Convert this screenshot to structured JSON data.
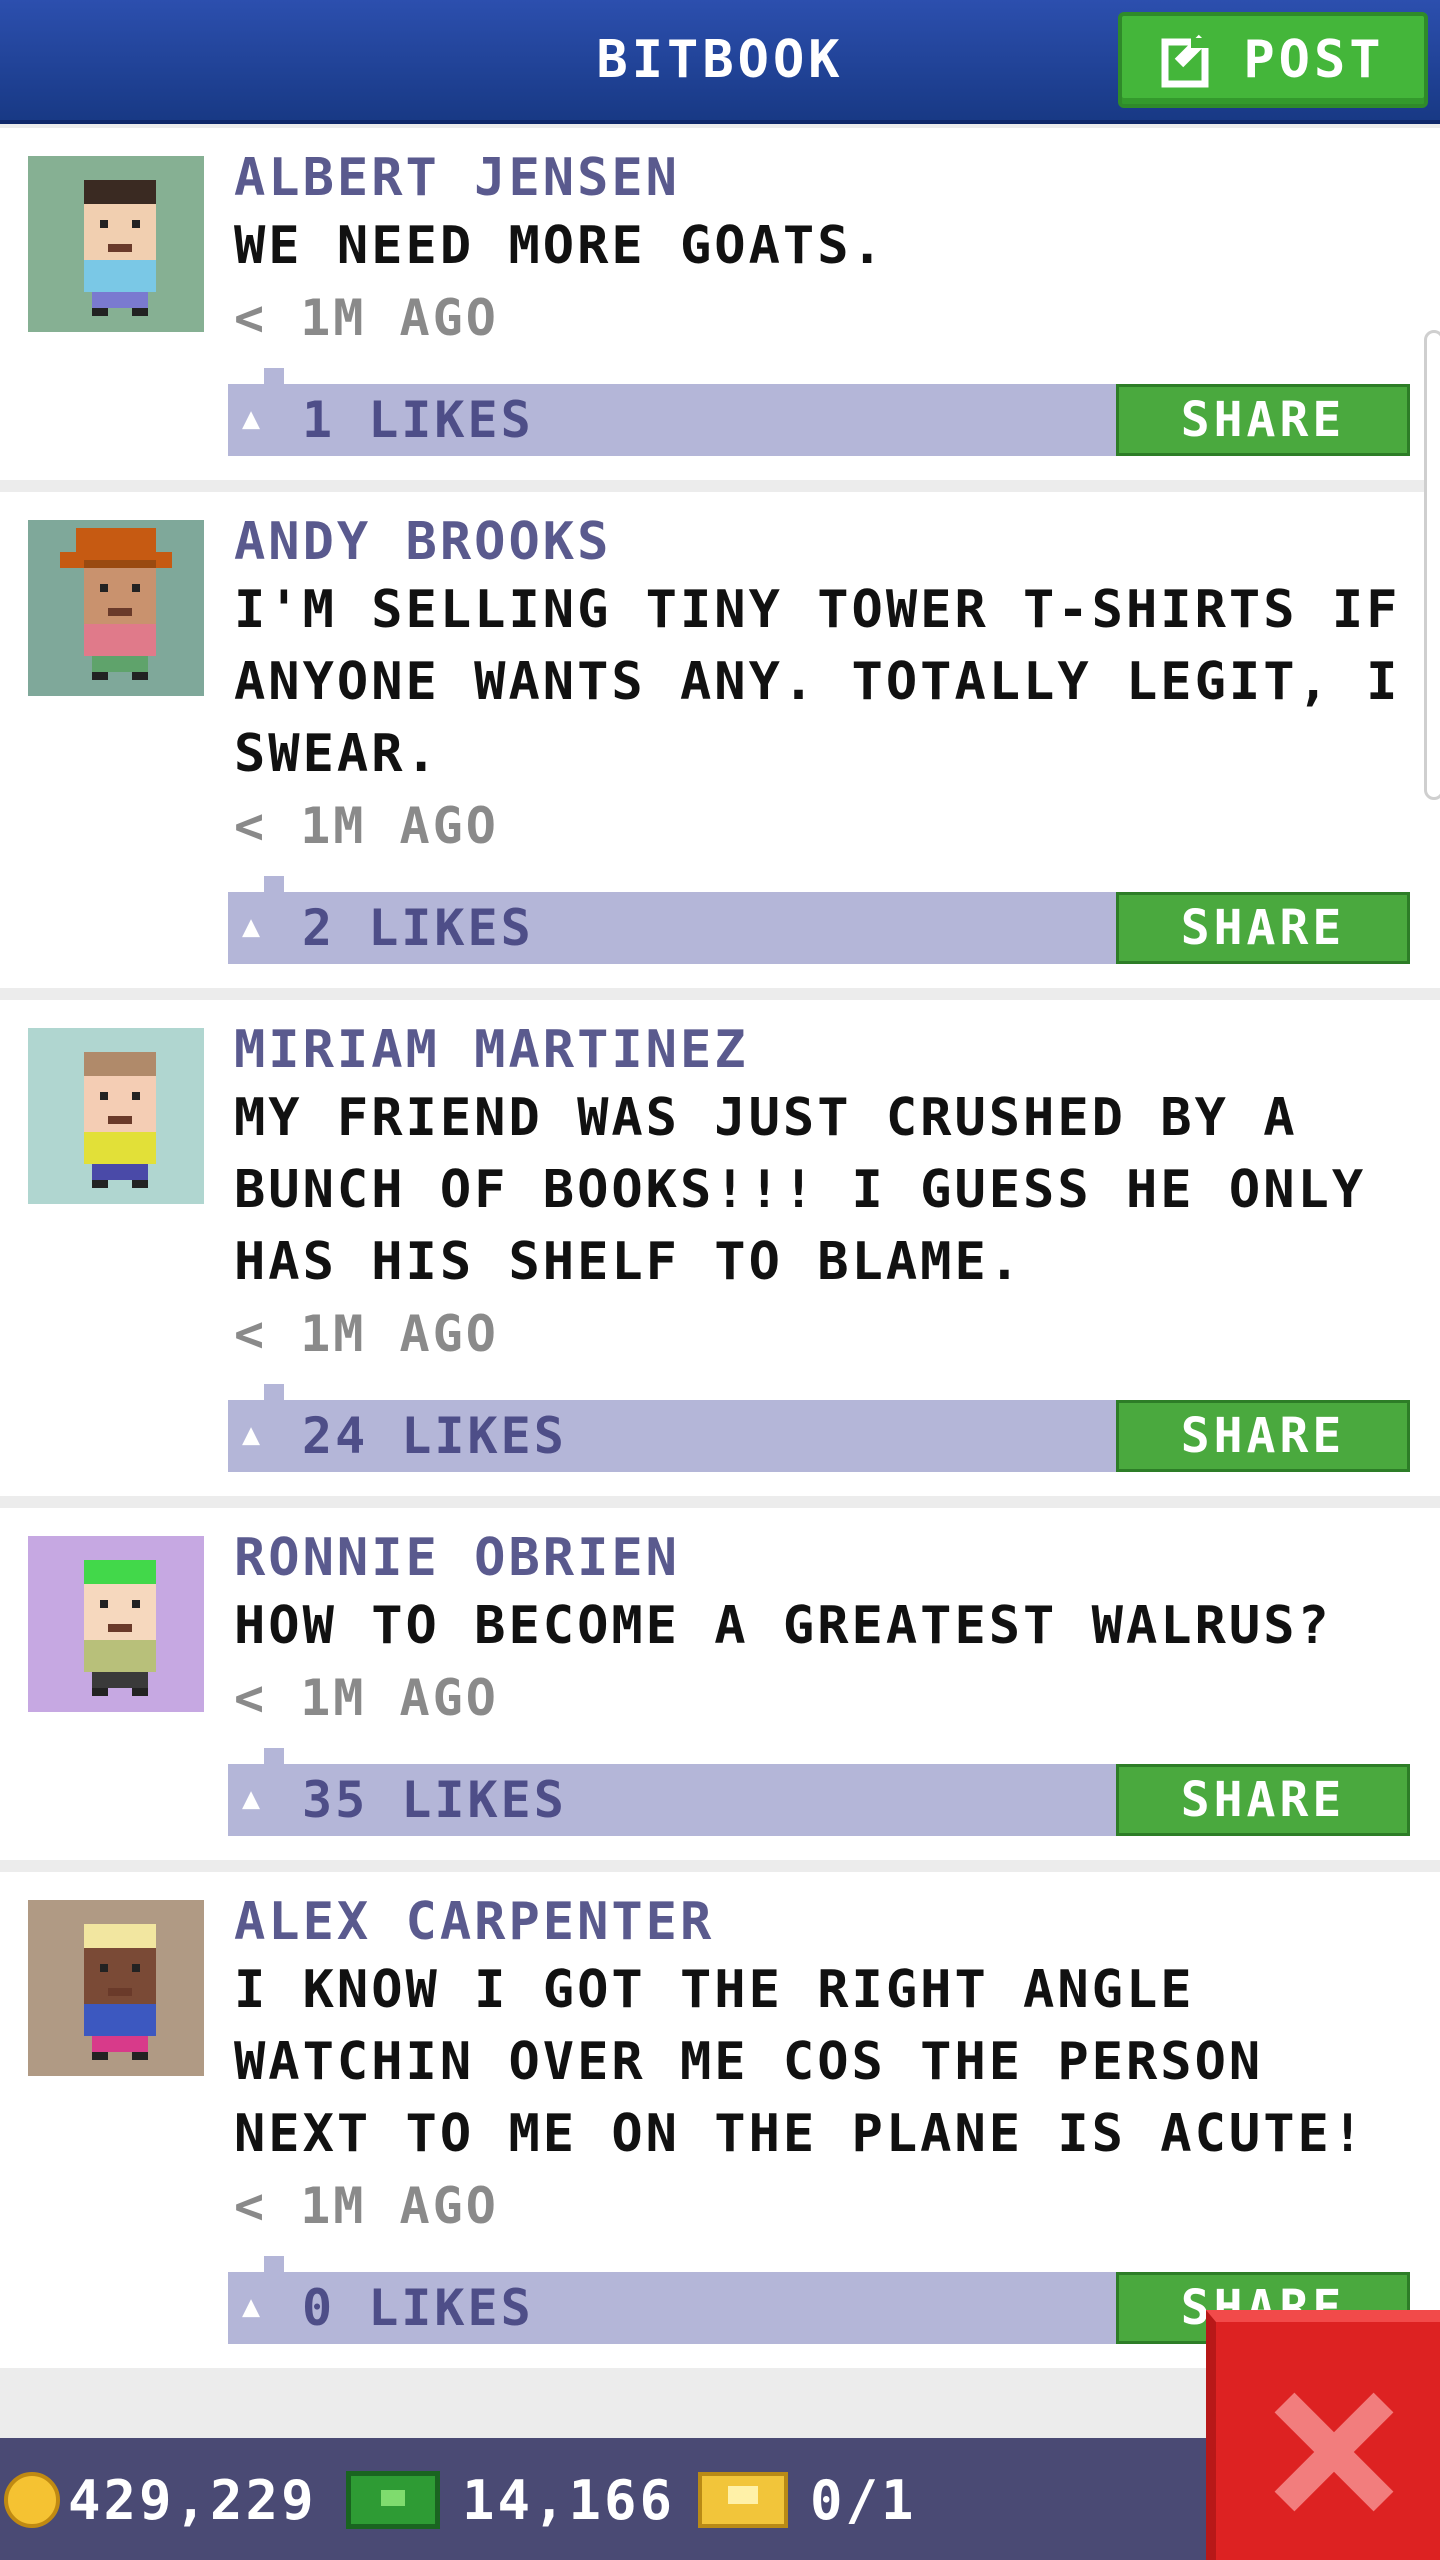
{
  "header": {
    "title": "BITBOOK",
    "post_label": "POST"
  },
  "posts": [
    {
      "author": "ALBERT JENSEN",
      "lines": [
        "WE NEED MORE GOATS."
      ],
      "time": "< 1M AGO",
      "likes": "1 LIKES",
      "share": "SHARE",
      "avatar": {
        "bg": "#86b093",
        "hair": "#3a2a22",
        "skin": "#f1cfb0",
        "shirt": "#7ac8e6",
        "pants": "#7a7ad0",
        "hat": null
      }
    },
    {
      "author": "ANDY BROOKS",
      "lines": [
        "I'M SELLING TINY TOWER T-SHIRTS IF",
        "ANYONE WANTS ANY. TOTALLY LEGIT, I",
        "SWEAR."
      ],
      "time": "< 1M AGO",
      "likes": "2 LIKES",
      "share": "SHARE",
      "avatar": {
        "bg": "#7fa89a",
        "hair": "#9a4a10",
        "skin": "#c9926e",
        "shirt": "#e07a8a",
        "pants": "#5fa36b",
        "hat": "#c65a12"
      }
    },
    {
      "author": "MIRIAM MARTINEZ",
      "lines": [
        "MY FRIEND WAS JUST CRUSHED BY A",
        "BUNCH OF BOOKS!!! I GUESS HE ONLY",
        "HAS HIS SHELF TO BLAME."
      ],
      "time": "< 1M AGO",
      "likes": "24 LIKES",
      "share": "SHARE",
      "avatar": {
        "bg": "#b0d6d0",
        "hair": "#b08a6a",
        "skin": "#f4cdb4",
        "shirt": "#e2e038",
        "pants": "#4a4aa8",
        "hat": null
      }
    },
    {
      "author": "RONNIE OBRIEN",
      "lines": [
        "HOW TO BECOME A GREATEST WALRUS?"
      ],
      "time": "< 1M AGO",
      "likes": "35 LIKES",
      "share": "SHARE",
      "avatar": {
        "bg": "#c6a8e2",
        "hair": "#42d84a",
        "skin": "#f6d8be",
        "shirt": "#b8c07a",
        "pants": "#3a3a3a",
        "hat": null
      }
    },
    {
      "author": "ALEX CARPENTER",
      "lines": [
        "I KNOW I GOT THE RIGHT ANGLE",
        "WATCHIN OVER ME COS THE PERSON",
        "NEXT TO ME ON THE PLANE IS ACUTE!"
      ],
      "time": "< 1M AGO",
      "likes": "0 LIKES",
      "share": "SHARE",
      "avatar": {
        "bg": "#b09a84",
        "hair": "#f2e6a0",
        "skin": "#7a4a36",
        "shirt": "#3c58c0",
        "pants": "#d83a8a",
        "hat": null
      }
    }
  ],
  "footer": {
    "coins": "429,229",
    "bux": "14,166",
    "tickets": "0/1"
  },
  "colors": {
    "header_blue": "#1f45a0",
    "share_green": "#4aa93e",
    "likes_bar": "#b4b6d8",
    "author_purple": "#5a5a8e",
    "close_red": "#dd2222"
  },
  "icons": [
    "edit-icon",
    "like-icon",
    "coin-icon",
    "bux-icon",
    "ticket-icon",
    "close-icon"
  ]
}
